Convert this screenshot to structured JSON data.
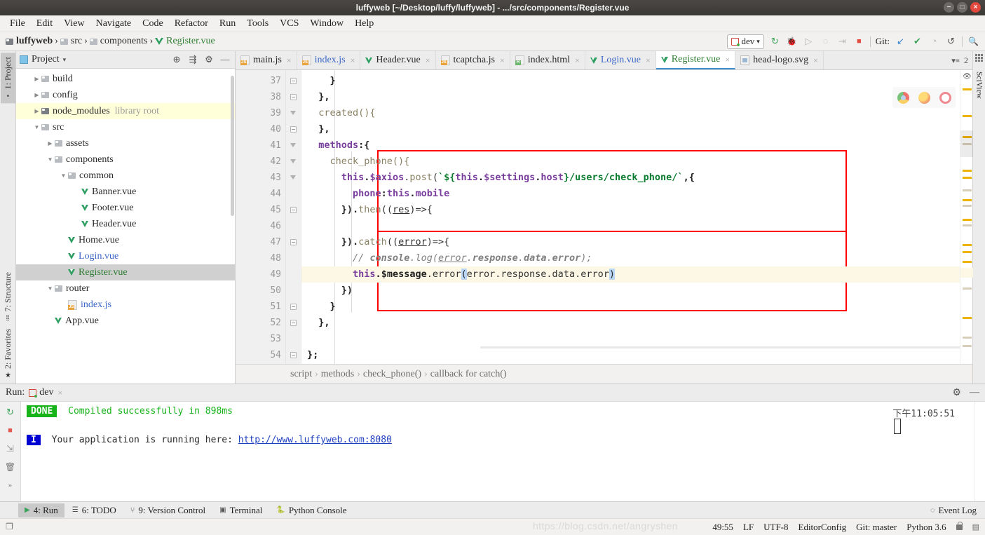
{
  "window": {
    "title": "luffyweb [~/Desktop/luffy/luffyweb] - .../src/components/Register.vue",
    "minimize": "−",
    "maximize": "□",
    "close": "×"
  },
  "menubar": {
    "items": [
      "File",
      "Edit",
      "View",
      "Navigate",
      "Code",
      "Refactor",
      "Run",
      "Tools",
      "VCS",
      "Window",
      "Help"
    ]
  },
  "breadcrumb": {
    "project": "luffyweb",
    "items": [
      "src",
      "components"
    ],
    "file": "Register.vue"
  },
  "toolbar": {
    "run_config": "dev",
    "dropdown_arrow": "▾",
    "run_icon": "↻",
    "debug_icon": "🐞",
    "coverage_icon": "▷",
    "profile_icon": "◌",
    "stepper_icon": "⇥",
    "stop_icon": "■",
    "git_label": "Git:",
    "git_update_icon": "↙",
    "git_commit_icon": "✔",
    "git_history_icon": "◔",
    "git_rollback_icon": "↺",
    "search_icon": "🔍"
  },
  "left_strip": {
    "project_tab": "1: Project",
    "structure_tab": "7: Structure",
    "favorites_tab": "2: Favorites"
  },
  "project_panel": {
    "title": "Project",
    "dropdown": "▾",
    "locate_icon": "⊕",
    "collapse_icon": "⇶",
    "settings_icon": "⚙",
    "hide_icon": "—",
    "tree": [
      {
        "label": "build",
        "indent": 1,
        "arrow": "▶",
        "icon": "folder",
        "state": "normal"
      },
      {
        "label": "config",
        "indent": 1,
        "arrow": "▶",
        "icon": "folder",
        "state": "normal"
      },
      {
        "label": "node_modules",
        "sublabel": "library root",
        "indent": 1,
        "arrow": "▶",
        "icon": "folder-dark",
        "state": "highlight"
      },
      {
        "label": "src",
        "indent": 1,
        "arrow": "▼",
        "icon": "folder",
        "state": "normal"
      },
      {
        "label": "assets",
        "indent": 2,
        "arrow": "▶",
        "icon": "folder",
        "state": "normal"
      },
      {
        "label": "components",
        "indent": 2,
        "arrow": "▼",
        "icon": "folder",
        "state": "normal"
      },
      {
        "label": "common",
        "indent": 3,
        "arrow": "▼",
        "icon": "folder",
        "state": "normal"
      },
      {
        "label": "Banner.vue",
        "indent": 4,
        "arrow": "",
        "icon": "vue",
        "state": "normal"
      },
      {
        "label": "Footer.vue",
        "indent": 4,
        "arrow": "",
        "icon": "vue",
        "state": "normal"
      },
      {
        "label": "Header.vue",
        "indent": 4,
        "arrow": "",
        "icon": "vue",
        "state": "normal"
      },
      {
        "label": "Home.vue",
        "indent": 3,
        "arrow": "",
        "icon": "vue",
        "state": "normal"
      },
      {
        "label": "Login.vue",
        "indent": 3,
        "arrow": "",
        "icon": "vue",
        "state": "blue"
      },
      {
        "label": "Register.vue",
        "indent": 3,
        "arrow": "",
        "icon": "vue",
        "state": "selected"
      },
      {
        "label": "router",
        "indent": 2,
        "arrow": "▼",
        "icon": "folder",
        "state": "normal"
      },
      {
        "label": "index.js",
        "indent": 3,
        "arrow": "",
        "icon": "js",
        "state": "blue"
      },
      {
        "label": "App.vue",
        "indent": 2,
        "arrow": "",
        "icon": "vue",
        "state": "normal"
      }
    ]
  },
  "editor_tabs": [
    {
      "label": "main.js",
      "icon": "js",
      "color": "normal",
      "active": false
    },
    {
      "label": "index.js",
      "icon": "js",
      "color": "blue",
      "active": false
    },
    {
      "label": "Header.vue",
      "icon": "vue",
      "color": "normal",
      "active": false
    },
    {
      "label": "tcaptcha.js",
      "icon": "js101",
      "color": "normal",
      "active": false
    },
    {
      "label": "index.html",
      "icon": "html",
      "color": "normal",
      "active": false
    },
    {
      "label": "Login.vue",
      "icon": "vue",
      "color": "blue",
      "active": false
    },
    {
      "label": "Register.vue",
      "icon": "vue",
      "color": "green",
      "active": true
    },
    {
      "label": "head-logo.svg",
      "icon": "svg",
      "color": "normal",
      "active": false
    }
  ],
  "editor_tabs_overflow": "2",
  "editor": {
    "first_line_number": 37,
    "lines": [
      {
        "n": 37,
        "fold": "minus",
        "tokens": [
          {
            "t": "    ",
            "c": "plain"
          },
          {
            "t": "}",
            "c": "bold"
          }
        ]
      },
      {
        "n": 38,
        "fold": "minus",
        "tokens": [
          {
            "t": "  ",
            "c": "plain"
          },
          {
            "t": "},",
            "c": "bold"
          }
        ]
      },
      {
        "n": 39,
        "fold": "tri",
        "tokens": [
          {
            "t": "  ",
            "c": "plain"
          },
          {
            "t": "created(){",
            "c": "fn"
          }
        ]
      },
      {
        "n": 40,
        "fold": "minus",
        "tokens": [
          {
            "t": "  ",
            "c": "plain"
          },
          {
            "t": "},",
            "c": "bold"
          }
        ]
      },
      {
        "n": 41,
        "fold": "tri",
        "tokens": [
          {
            "t": "  ",
            "c": "plain"
          },
          {
            "t": "methods",
            "c": "kw"
          },
          {
            "t": ":{",
            "c": "bold"
          }
        ]
      },
      {
        "n": 42,
        "fold": "tri",
        "tokens": [
          {
            "t": "    ",
            "c": "plain"
          },
          {
            "t": "check_phone(){",
            "c": "fn"
          }
        ]
      },
      {
        "n": 43,
        "fold": "tri",
        "tokens": [
          {
            "t": "      ",
            "c": "plain"
          },
          {
            "t": "this",
            "c": "kw"
          },
          {
            "t": ".",
            "c": "bold"
          },
          {
            "t": "$axios",
            "c": "kw"
          },
          {
            "t": ".",
            "c": "op"
          },
          {
            "t": "post",
            "c": "fn"
          },
          {
            "t": "(",
            "c": "op"
          },
          {
            "t": "`${",
            "c": "str"
          },
          {
            "t": "this",
            "c": "kw"
          },
          {
            "t": ".",
            "c": "bold"
          },
          {
            "t": "$settings",
            "c": "kw"
          },
          {
            "t": ".",
            "c": "bold"
          },
          {
            "t": "host",
            "c": "kw"
          },
          {
            "t": "}/users/check_phone/`",
            "c": "str"
          },
          {
            "t": ",{",
            "c": "bold"
          }
        ]
      },
      {
        "n": 44,
        "fold": "",
        "tokens": [
          {
            "t": "        ",
            "c": "plain"
          },
          {
            "t": "phone",
            "c": "kw"
          },
          {
            "t": ":",
            "c": "bold"
          },
          {
            "t": "this",
            "c": "kw"
          },
          {
            "t": ".",
            "c": "bold"
          },
          {
            "t": "mobile",
            "c": "kw"
          }
        ]
      },
      {
        "n": 45,
        "fold": "minus",
        "tokens": [
          {
            "t": "      ",
            "c": "plain"
          },
          {
            "t": "}).",
            "c": "bold"
          },
          {
            "t": "then",
            "c": "fn"
          },
          {
            "t": "((",
            "c": "op"
          },
          {
            "t": "res",
            "c": "var"
          },
          {
            "t": ")=>{",
            "c": "op"
          }
        ]
      },
      {
        "n": 46,
        "fold": "",
        "tokens": []
      },
      {
        "n": 47,
        "fold": "minus",
        "tokens": [
          {
            "t": "      ",
            "c": "plain"
          },
          {
            "t": "}).",
            "c": "bold"
          },
          {
            "t": "catch",
            "c": "fn"
          },
          {
            "t": "((",
            "c": "op"
          },
          {
            "t": "error",
            "c": "var"
          },
          {
            "t": ")=>{",
            "c": "op"
          }
        ]
      },
      {
        "n": 48,
        "fold": "",
        "tokens": [
          {
            "t": "        ",
            "c": "plain"
          },
          {
            "t": "// ",
            "c": "cmt-i"
          },
          {
            "t": "console",
            "c": "cmt"
          },
          {
            "t": ".",
            "c": "cmt-i"
          },
          {
            "t": "log(",
            "c": "cmt-i"
          },
          {
            "t": "error",
            "c": "cmt-var"
          },
          {
            "t": ".",
            "c": "cmt-i"
          },
          {
            "t": "response",
            "c": "cmt"
          },
          {
            "t": ".",
            "c": "cmt-i"
          },
          {
            "t": "data",
            "c": "cmt"
          },
          {
            "t": ".",
            "c": "cmt-i"
          },
          {
            "t": "error",
            "c": "cmt"
          },
          {
            "t": ");",
            "c": "cmt-i"
          }
        ]
      },
      {
        "n": 49,
        "fold": "",
        "current": true,
        "tokens": [
          {
            "t": "        ",
            "c": "plain"
          },
          {
            "t": "this",
            "c": "kw"
          },
          {
            "t": ".",
            "c": "bold"
          },
          {
            "t": "$message",
            "c": "bold"
          },
          {
            "t": ".",
            "c": "op"
          },
          {
            "t": "error",
            "c": "id"
          },
          {
            "t": "(",
            "c": "sel"
          },
          {
            "t": "error.response.data.error",
            "c": "id"
          },
          {
            "t": ")",
            "c": "sel"
          }
        ]
      },
      {
        "n": 50,
        "fold": "",
        "tokens": [
          {
            "t": "      ",
            "c": "plain"
          },
          {
            "t": "})",
            "c": "bold"
          }
        ]
      },
      {
        "n": 51,
        "fold": "minus",
        "tokens": [
          {
            "t": "    ",
            "c": "plain"
          },
          {
            "t": "}",
            "c": "bold"
          }
        ]
      },
      {
        "n": 52,
        "fold": "minus",
        "tokens": [
          {
            "t": "  ",
            "c": "plain"
          },
          {
            "t": "},",
            "c": "bold"
          }
        ]
      },
      {
        "n": 53,
        "fold": "",
        "tokens": []
      },
      {
        "n": 54,
        "fold": "minus",
        "tokens": [
          {
            "t": "};",
            "c": "bold"
          }
        ]
      }
    ],
    "breadcrumb": [
      "script",
      "methods",
      "check_phone()",
      "callback for catch()"
    ],
    "breadcrumb_sep": "›"
  },
  "sciview": {
    "label": "SciView",
    "eye_icon": "👁"
  },
  "browser_preview": {
    "chrome": "chrome-icon",
    "firefox": "firefox-icon",
    "opera": "opera-icon"
  },
  "run_panel": {
    "label": "Run:",
    "config": "dev",
    "close": "×",
    "settings_icon": "⚙",
    "hide_icon": "—",
    "rerun_icon": "↻",
    "stop_icon": "■",
    "scroll_icon": "⇲",
    "trash_icon": "🗑",
    "more_icon": "»",
    "lines": [
      {
        "type": "done",
        "badge": "DONE",
        "text": "Compiled successfully in 898ms"
      },
      {
        "type": "blank"
      },
      {
        "type": "info",
        "badge": "I",
        "prefix": "Your application is running here: ",
        "url": "http://www.luffyweb.com:8080"
      }
    ],
    "timestamp": "下午11:05:51"
  },
  "bottom_tabs": [
    {
      "icon": "▶",
      "label": "4: Run",
      "active": true
    },
    {
      "icon": "☰",
      "label": "6: TODO",
      "active": false
    },
    {
      "icon": "⑂",
      "label": "9: Version Control",
      "active": false
    },
    {
      "icon": "▣",
      "label": "Terminal",
      "active": false
    },
    {
      "icon": "🐍",
      "label": "Python Console",
      "active": false
    }
  ],
  "event_log": {
    "icon": "◌",
    "label": "Event Log"
  },
  "status_bar": {
    "position": "49:55",
    "line_sep": "LF",
    "encoding": "UTF-8",
    "editorconfig": "EditorConfig",
    "git_branch": "Git: master",
    "interpreter": "Python 3.6",
    "lock_icon": "lock-icon",
    "watermark": "https://blog.csdn.net/angryshen"
  },
  "colors": {
    "accent_blue": "#3f8fd0",
    "vue_green": "#2f9e62",
    "error_red": "#ff0000",
    "done_green": "#17b31b",
    "info_blue": "#0000d2",
    "highlight_yellow": "#fdf8e6"
  }
}
